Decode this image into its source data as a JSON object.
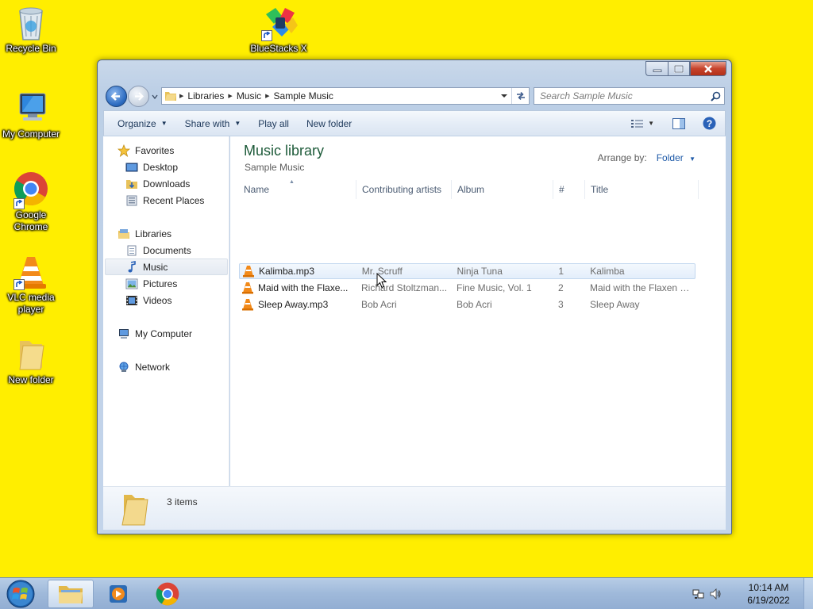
{
  "desktop": {
    "icons": [
      {
        "label": "Recycle Bin"
      },
      {
        "label": "BlueStacks X"
      },
      {
        "label": "My Computer"
      },
      {
        "label": "Google Chrome"
      },
      {
        "label": "VLC media player"
      },
      {
        "label": "New folder"
      }
    ],
    "background_color": "#ffee00"
  },
  "window": {
    "breadcrumb": [
      "Libraries",
      "Music",
      "Sample Music"
    ],
    "search_placeholder": "Search Sample Music",
    "toolbar": {
      "organize": "Organize",
      "share_with": "Share with",
      "play_all": "Play all",
      "new_folder": "New folder"
    },
    "nav": {
      "favorites": "Favorites",
      "desktop": "Desktop",
      "downloads": "Downloads",
      "recent_places": "Recent Places",
      "libraries": "Libraries",
      "documents": "Documents",
      "music": "Music",
      "pictures": "Pictures",
      "videos": "Videos",
      "my_computer": "My Computer",
      "network": "Network"
    },
    "library": {
      "title": "Music library",
      "subtitle": "Sample Music",
      "arrange_label": "Arrange by:",
      "arrange_value": "Folder"
    },
    "columns": [
      "Name",
      "Contributing artists",
      "Album",
      "#",
      "Title"
    ],
    "files": [
      {
        "name": "Kalimba.mp3",
        "artist": "Mr. Scruff",
        "album": "Ninja Tuna",
        "track": "1",
        "title": "Kalimba"
      },
      {
        "name": "Maid with the Flaxe...",
        "artist": "Richard Stoltzman...",
        "album": "Fine Music, Vol. 1",
        "track": "2",
        "title": "Maid with the Flaxen H..."
      },
      {
        "name": "Sleep Away.mp3",
        "artist": "Bob Acri",
        "album": "Bob Acri",
        "track": "3",
        "title": "Sleep Away"
      }
    ],
    "status": "3 items"
  },
  "taskbar": {
    "time": "10:14 AM",
    "date": "6/19/2022"
  }
}
